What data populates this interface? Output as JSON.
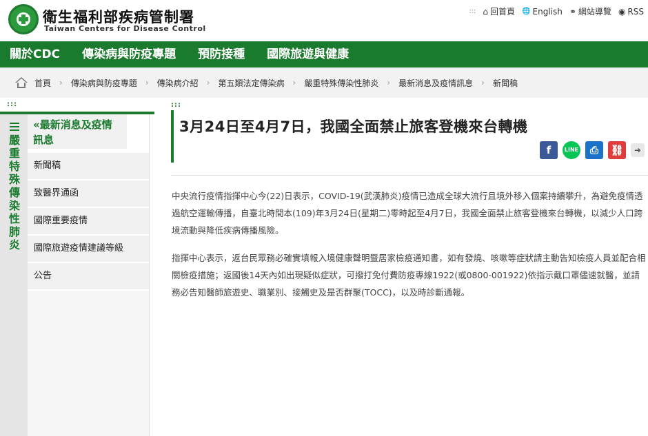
{
  "header": {
    "title": "衛生福利部疾病管制署",
    "subtitle": "Taiwan Centers for Disease Control",
    "accesskey": ":::",
    "links": [
      {
        "icon": "home-icon",
        "glyph": "⌂",
        "label": "回首頁"
      },
      {
        "icon": "globe-icon",
        "glyph": "🌐",
        "label": "English"
      },
      {
        "icon": "sitemap-icon",
        "glyph": "⚭",
        "label": "網站導覽"
      },
      {
        "icon": "rss-icon",
        "glyph": "◉",
        "label": "RSS"
      }
    ]
  },
  "mainnav": [
    "關於CDC",
    "傳染病與防疫專題",
    "預防接種",
    "國際旅遊與健康"
  ],
  "breadcrumb": [
    "首頁",
    "傳染病與防疫專題",
    "傳染病介紹",
    "第五類法定傳染病",
    "嚴重特殊傳染性肺炎",
    "最新消息及疫情訊息",
    "新聞稿"
  ],
  "sidebar": {
    "dots": ":::",
    "vertical_title": "嚴重特殊傳染性肺炎",
    "section_title": "«最新消息及疫情訊息",
    "items": [
      "新聞稿",
      "致醫界通函",
      "國際重要疫情",
      "國際旅遊疫情建議等級",
      "公告"
    ]
  },
  "content": {
    "dots": ":::",
    "title": "3月24日至4月7日，我國全面禁止旅客登機來台轉機",
    "share": [
      "f",
      "LINE",
      "⎙",
      "⛓",
      "➜"
    ],
    "paragraphs": [
      "中央流行疫情指揮中心今(22)日表示，COVID-19(武漢肺炎)疫情已造成全球大流行且境外移入個案持續攀升，為避免疫情透過航空運輸傳播，自臺北時間本(109)年3月24日(星期二)零時起至4月7日，我國全面禁止旅客登機來台轉機，以減少人口跨境流動與降低疾病傳播風險。",
      "指揮中心表示，返台民眾務必確實填報入境健康聲明暨居家檢疫通知書，如有發燒、咳嗽等症狀請主動告知檢疫人員並配合相關檢疫措施；返國後14天內如出現疑似症狀，可撥打免付費防疫專線1922(或0800-001922)依指示戴口罩儘速就醫，並請務必告知醫師旅遊史、職業別、接觸史及是否群聚(TOCC)，以及時診斷通報。"
    ]
  },
  "colors": {
    "brand": "#1a7a2e",
    "breadcrumb_bg": "#f2f2f2",
    "sidebar_bg": "#f0f0f0"
  }
}
